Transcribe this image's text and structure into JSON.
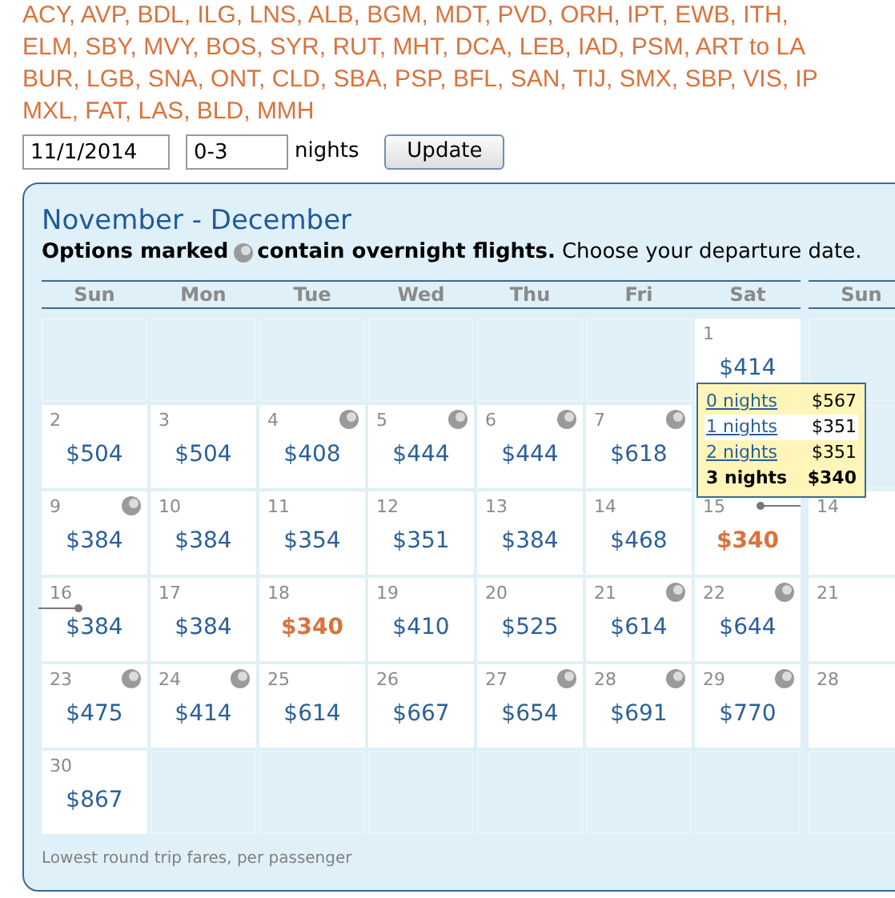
{
  "airports": [
    "ACY, AVP, BDL, ILG, LNS, ALB, BGM, MDT, PVD, ORH, IPT, EWB, ITH,",
    "ELM, SBY, MVY, BOS, SYR, RUT, MHT, DCA, LEB, IAD, PSM, ART to LA",
    "BUR, LGB, SNA, ONT, CLD, SBA, PSP, BFL, SAN, TIJ, SMX, SBP, VIS, IP",
    "MXL, FAT, LAS, BLD, MMH"
  ],
  "search": {
    "date": "11/1/2014",
    "nights": "0-3",
    "nights_label": "nights",
    "button": "Update"
  },
  "calendar": {
    "title": "November - December",
    "legend_bold": "Options marked",
    "legend_bold_2": "contain overnight flights.",
    "legend_rest": "Choose your departure date.",
    "weekdays": [
      "Sun",
      "Mon",
      "Tue",
      "Wed",
      "Thu",
      "Fri",
      "Sat",
      "Sun"
    ],
    "weeks": [
      [
        {
          "kind": "empty"
        },
        {
          "kind": "empty"
        },
        {
          "kind": "empty"
        },
        {
          "kind": "empty"
        },
        {
          "kind": "empty"
        },
        {
          "kind": "empty"
        },
        {
          "kind": "fare",
          "day": "1",
          "price": "$414",
          "overnight": false,
          "lowest": false,
          "popup": {
            "options": [
              {
                "label": "0 nights",
                "price": "$567",
                "selected": false,
                "hovered": false
              },
              {
                "label": "1 nights",
                "price": "$351",
                "selected": false,
                "hovered": true
              },
              {
                "label": "2 nights",
                "price": "$351",
                "selected": false,
                "hovered": false
              },
              {
                "label": "3 nights",
                "price": "$340",
                "selected": true,
                "hovered": false
              }
            ]
          }
        },
        {
          "kind": "empty"
        }
      ],
      [
        {
          "kind": "fare",
          "day": "2",
          "price": "$504",
          "overnight": false,
          "lowest": false
        },
        {
          "kind": "fare",
          "day": "3",
          "price": "$504",
          "overnight": false,
          "lowest": false
        },
        {
          "kind": "fare",
          "day": "4",
          "price": "$408",
          "overnight": true,
          "lowest": false
        },
        {
          "kind": "fare",
          "day": "5",
          "price": "$444",
          "overnight": true,
          "lowest": false
        },
        {
          "kind": "fare",
          "day": "6",
          "price": "$444",
          "overnight": true,
          "lowest": false
        },
        {
          "kind": "fare",
          "day": "7",
          "price": "$618",
          "overnight": true,
          "lowest": false
        },
        {
          "kind": "empty"
        },
        {
          "kind": "empty"
        }
      ],
      [
        {
          "kind": "fare",
          "day": "9",
          "price": "$384",
          "overnight": true,
          "lowest": false
        },
        {
          "kind": "fare",
          "day": "10",
          "price": "$384",
          "overnight": false,
          "lowest": false
        },
        {
          "kind": "fare",
          "day": "11",
          "price": "$354",
          "overnight": false,
          "lowest": false
        },
        {
          "kind": "fare",
          "day": "12",
          "price": "$351",
          "overnight": false,
          "lowest": false
        },
        {
          "kind": "fare",
          "day": "13",
          "price": "$384",
          "overnight": false,
          "lowest": false
        },
        {
          "kind": "fare",
          "day": "14",
          "price": "$468",
          "overnight": false,
          "lowest": false
        },
        {
          "kind": "fare",
          "day": "15",
          "price": "$340",
          "overnight": false,
          "lowest": true,
          "trip_start": true
        },
        {
          "kind": "day",
          "day": "14"
        }
      ],
      [
        {
          "kind": "fare",
          "day": "16",
          "price": "$384",
          "overnight": false,
          "lowest": false,
          "trip_end": true
        },
        {
          "kind": "fare",
          "day": "17",
          "price": "$384",
          "overnight": false,
          "lowest": false
        },
        {
          "kind": "fare",
          "day": "18",
          "price": "$340",
          "overnight": false,
          "lowest": true
        },
        {
          "kind": "fare",
          "day": "19",
          "price": "$410",
          "overnight": false,
          "lowest": false
        },
        {
          "kind": "fare",
          "day": "20",
          "price": "$525",
          "overnight": false,
          "lowest": false
        },
        {
          "kind": "fare",
          "day": "21",
          "price": "$614",
          "overnight": true,
          "lowest": false
        },
        {
          "kind": "fare",
          "day": "22",
          "price": "$644",
          "overnight": true,
          "lowest": false
        },
        {
          "kind": "day",
          "day": "21"
        }
      ],
      [
        {
          "kind": "fare",
          "day": "23",
          "price": "$475",
          "overnight": true,
          "lowest": false
        },
        {
          "kind": "fare",
          "day": "24",
          "price": "$414",
          "overnight": true,
          "lowest": false
        },
        {
          "kind": "fare",
          "day": "25",
          "price": "$614",
          "overnight": false,
          "lowest": false
        },
        {
          "kind": "fare",
          "day": "26",
          "price": "$667",
          "overnight": false,
          "lowest": false
        },
        {
          "kind": "fare",
          "day": "27",
          "price": "$654",
          "overnight": true,
          "lowest": false
        },
        {
          "kind": "fare",
          "day": "28",
          "price": "$691",
          "overnight": true,
          "lowest": false
        },
        {
          "kind": "fare",
          "day": "29",
          "price": "$770",
          "overnight": true,
          "lowest": false
        },
        {
          "kind": "day",
          "day": "28"
        }
      ],
      [
        {
          "kind": "fare",
          "day": "30",
          "price": "$867",
          "overnight": false,
          "lowest": false
        },
        {
          "kind": "empty"
        },
        {
          "kind": "empty"
        },
        {
          "kind": "empty"
        },
        {
          "kind": "empty"
        },
        {
          "kind": "empty"
        },
        {
          "kind": "empty"
        },
        {
          "kind": "empty"
        }
      ]
    ],
    "footnote": "Lowest round trip fares, per passenger"
  }
}
